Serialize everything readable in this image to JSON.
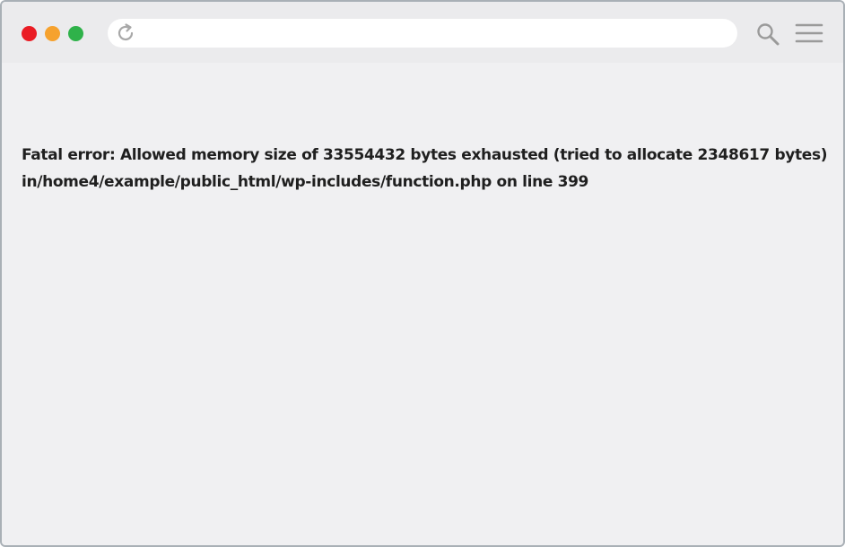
{
  "browser": {
    "address_bar": {
      "value": "",
      "placeholder": ""
    },
    "traffic_lights": {
      "close_color": "#ea1c24",
      "minimize_color": "#f6a22e",
      "maximize_color": "#2fb24a"
    },
    "icons": [
      "reload-icon",
      "search-icon",
      "menu-icon"
    ]
  },
  "page": {
    "error_line_1": "Fatal error: Allowed memory size of 33554432 bytes exhausted (tried to allocate 2348617 bytes)",
    "error_line_2": "in/home4/example/public_html/wp-includes/function.php on line 399"
  }
}
